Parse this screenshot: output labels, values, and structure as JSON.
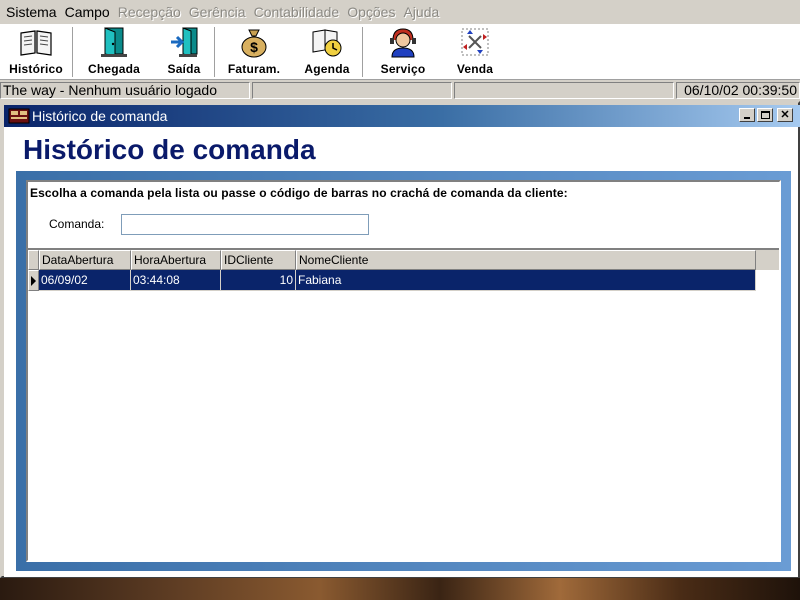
{
  "menu": {
    "items": [
      {
        "label": "Sistema",
        "enabled": true
      },
      {
        "label": "Campo",
        "enabled": true
      },
      {
        "label": "Recepção",
        "enabled": false
      },
      {
        "label": "Gerência",
        "enabled": false
      },
      {
        "label": "Contabilidade",
        "enabled": false
      },
      {
        "label": "Opções",
        "enabled": false
      },
      {
        "label": "Ajuda",
        "enabled": false
      }
    ]
  },
  "toolbar": {
    "buttons": [
      {
        "label": "Histórico",
        "icon": "book-icon"
      },
      {
        "label": "Chegada",
        "icon": "door-open-icon"
      },
      {
        "label": "Saída",
        "icon": "exit-door-icon"
      },
      {
        "label": "Faturam.",
        "icon": "money-bag-icon"
      },
      {
        "label": "Agenda",
        "icon": "agenda-clock-icon"
      },
      {
        "label": "Serviço",
        "icon": "attendant-icon"
      },
      {
        "label": "Venda",
        "icon": "recycle-icon"
      }
    ]
  },
  "statusbar": {
    "user_status": "The way - Nenhum usuário logado",
    "panel2": "",
    "panel3": "",
    "datetime": "06/10/02 00:39:50"
  },
  "window": {
    "title": "Histórico de comanda",
    "heading": "Histórico de comanda",
    "instructions": "Escolha a comanda pela lista ou passe o código de barras no crachá de comanda da cliente:",
    "comanda_label": "Comanda:",
    "comanda_value": ""
  },
  "grid": {
    "columns": [
      "DataAbertura",
      "HoraAbertura",
      "IDCliente",
      "NomeCliente"
    ],
    "rows": [
      {
        "DataAbertura": "06/09/02",
        "HoraAbertura": "03:44:08",
        "IDCliente": "10",
        "NomeCliente": "Fabiana"
      }
    ]
  },
  "colors": {
    "titlebar_start": "#0a246a",
    "titlebar_end": "#a6caf0",
    "heading": "#0a1a6a",
    "selection": "#0a246a"
  }
}
